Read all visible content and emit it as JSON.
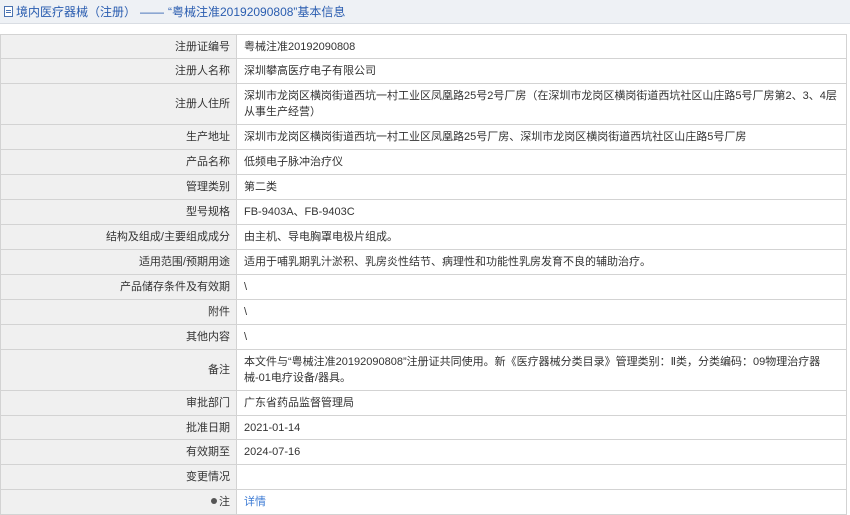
{
  "header": {
    "category": "境内医疗器械（注册）",
    "separator": "——",
    "title": "“粤械注准20192090808”基本信息"
  },
  "rows": [
    {
      "label": "注册证编号",
      "value": "粤械注准20192090808"
    },
    {
      "label": "注册人名称",
      "value": "深圳攀高医疗电子有限公司"
    },
    {
      "label": "注册人住所",
      "value": "深圳市龙岗区横岗街道西坑一村工业区凤凰路25号2号厂房（在深圳市龙岗区横岗街道西坑社区山庄路5号厂房第2、3、4层从事生产经营）"
    },
    {
      "label": "生产地址",
      "value": "深圳市龙岗区横岗街道西坑一村工业区凤凰路25号厂房、深圳市龙岗区横岗街道西坑社区山庄路5号厂房"
    },
    {
      "label": "产品名称",
      "value": "低频电子脉冲治疗仪"
    },
    {
      "label": "管理类别",
      "value": "第二类"
    },
    {
      "label": "型号规格",
      "value": "FB-9403A、FB-9403C"
    },
    {
      "label": "结构及组成/主要组成成分",
      "value": "由主机、导电胸罩电极片组成。"
    },
    {
      "label": "适用范围/预期用途",
      "value": "适用于哺乳期乳汁淤积、乳房炎性结节、病理性和功能性乳房发育不良的辅助治疗。"
    },
    {
      "label": "产品储存条件及有效期",
      "value": "\\"
    },
    {
      "label": "附件",
      "value": "\\"
    },
    {
      "label": "其他内容",
      "value": "\\"
    },
    {
      "label": "备注",
      "value": "本文件与“粤械注准20192090808”注册证共同使用。新《医疗器械分类目录》管理类别：Ⅱ类，分类编码：09物理治疗器械-01电疗设备/器具。"
    },
    {
      "label": "审批部门",
      "value": "广东省药品监督管理局"
    },
    {
      "label": "批准日期",
      "value": "2021-01-14"
    },
    {
      "label": "有效期至",
      "value": "2024-07-16"
    },
    {
      "label": "变更情况",
      "value": ""
    },
    {
      "label": "注",
      "value": "详情",
      "icon": "pin-icon"
    }
  ]
}
